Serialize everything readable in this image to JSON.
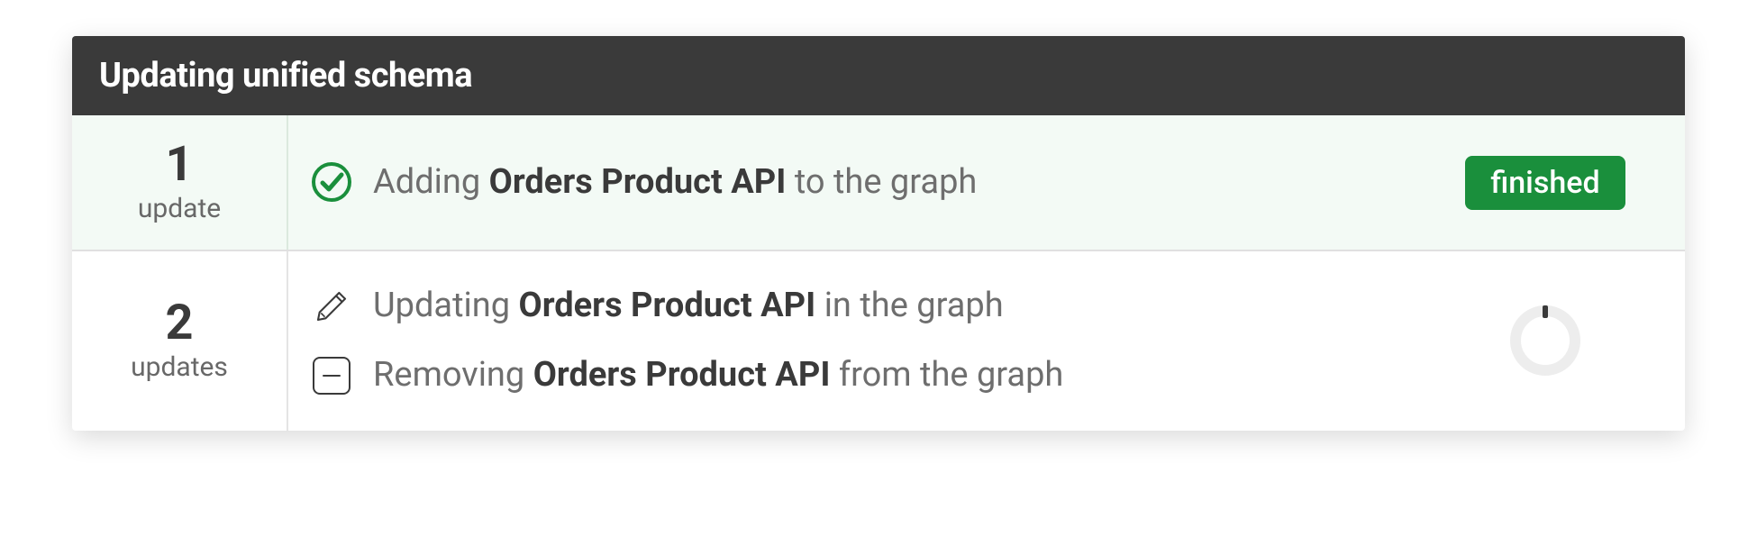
{
  "header": {
    "title": "Updating unified schema"
  },
  "groups": [
    {
      "count": "1",
      "count_label": "update",
      "status": "finished",
      "status_type": "badge",
      "success": true,
      "items": [
        {
          "icon": "check",
          "prefix": "Adding ",
          "strong": "Orders Product API",
          "suffix": " to the graph"
        }
      ]
    },
    {
      "count": "2",
      "count_label": "updates",
      "status": "",
      "status_type": "spinner",
      "success": false,
      "items": [
        {
          "icon": "pencil",
          "prefix": "Updating ",
          "strong": "Orders Product API",
          "suffix": " in the graph"
        },
        {
          "icon": "remove",
          "prefix": "Removing ",
          "strong": "Orders Product API",
          "suffix": " from the graph"
        }
      ]
    }
  ]
}
